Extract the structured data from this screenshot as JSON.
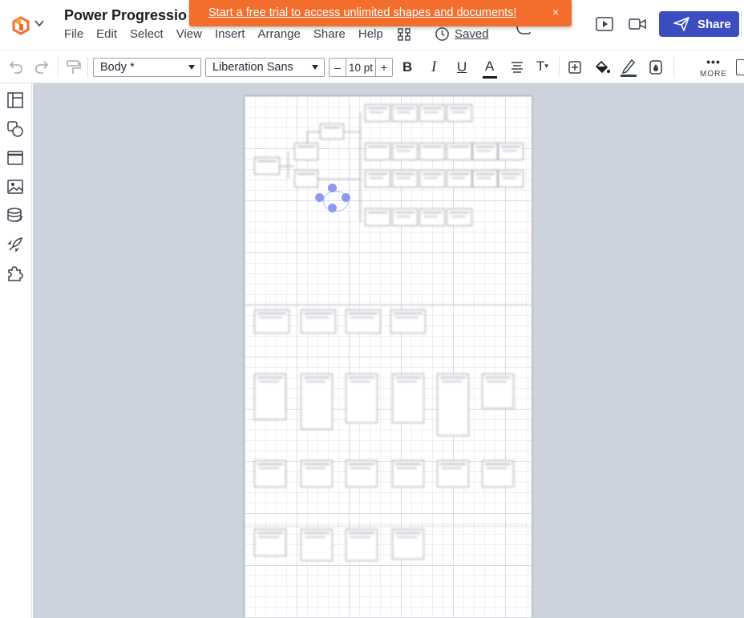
{
  "app": {
    "document_title": "Power Progressio",
    "menu": [
      "File",
      "Edit",
      "Select",
      "View",
      "Insert",
      "Arrange",
      "Share",
      "Help"
    ],
    "saved_label": "Saved",
    "share_label": "Share"
  },
  "banner": {
    "text": "Start a free trial to access unlimited shapes and documents!",
    "close_glyph": "×",
    "color": "#f36d2c"
  },
  "toolbar": {
    "style_select": "Body *",
    "font_select": "Liberation Sans",
    "font_size": "10 pt",
    "minus": "–",
    "plus": "+",
    "bold": "B",
    "italic": "I",
    "underline": "U",
    "font_color_letter": "A",
    "text_options_letter": "T",
    "more_label": "MORE",
    "more_dots": "•••"
  },
  "icons": {
    "logo": "lucid-logo-icon",
    "undo": "undo-icon",
    "redo": "redo-icon",
    "format_painter": "paint-roller-icon",
    "present": "present-icon",
    "video": "video-icon",
    "share": "paper-plane-icon"
  },
  "left_rail": [
    "pages-icon",
    "shapes-icon",
    "frame-icon",
    "image-icon",
    "data-icon",
    "rocket-icon",
    "plugin-icon"
  ],
  "colors": {
    "brand_accent": "#3b4dc0",
    "canvas_bg": "#ccd3dc",
    "selection": "#8e98f0"
  }
}
